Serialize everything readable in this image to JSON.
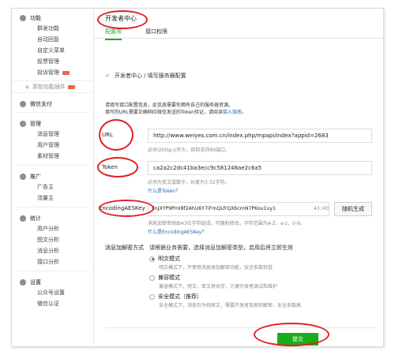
{
  "sidebar": {
    "groups": [
      {
        "title": "功能",
        "icon": "grid-icon",
        "items": [
          "群发功能",
          "自动回复",
          "自定义菜单",
          "投票管理",
          "投诉管理"
        ],
        "add_label": "添加功能插件"
      },
      {
        "title": "微信支付",
        "icon": "wallet-icon",
        "items": []
      },
      {
        "title": "管理",
        "icon": "folder-icon",
        "items": [
          "消息管理",
          "用户管理",
          "素材管理"
        ]
      },
      {
        "title": "推广",
        "icon": "megaphone-icon",
        "items": [
          "广告主",
          "流量主"
        ]
      },
      {
        "title": "统计",
        "icon": "chart-icon",
        "items": [
          "用户分析",
          "图文分析",
          "消息分析",
          "接口分析"
        ]
      },
      {
        "title": "设置",
        "icon": "gear-icon",
        "items": [
          "公众号设置",
          "微信认证"
        ]
      }
    ]
  },
  "header": {
    "title": "开发者中心",
    "tabs": [
      "配置项",
      "接口权限"
    ]
  },
  "breadcrumb": {
    "back": "<",
    "path": "开发者中心 / 填写服务器配置"
  },
  "intro": {
    "line1": "请填写接口配置信息，此信息需要你拥有自己的服务器资源。",
    "line2": "填写的URL需要正确响应微信发送的Token验证，请阅读",
    "link": "接入指南。"
  },
  "form": {
    "url": {
      "label": "URL",
      "value": "http://www.weiyes.com.cn/index.php/mpapi/index?appid=2683",
      "hint": "必须以http://开头，目前支持80端口。"
    },
    "token": {
      "label": "Token",
      "value": "ca2a2c2dc41ba3ecc9c581248ae2c6a5",
      "hint": "必须为英文或数字，长度为3-32字符。",
      "link": "什么是Token？"
    },
    "aes": {
      "label": "EncodingAESKey",
      "value": "lnJXYP9Pml8f2AhU6Y7iFmQLfrQXbcmN7PKou1uy1",
      "counter": "43 /43",
      "generate": "随机生成",
      "hint": "消息加密密钥由43位字符组成，可随机修改，字符范围为A-Z，a-z，0-9。",
      "link": "什么是EncodingAESKey？"
    },
    "encryption": {
      "label": "消息加解密方式",
      "desc": "请根据业务需要，选择消息加解密类型，启用后将立即生效",
      "options": [
        {
          "title": "明文模式",
          "desc": "明文模式下，不使用消息体加解密功能，安全系数较低",
          "checked": true
        },
        {
          "title": "兼容模式",
          "desc": "兼容模式下，明文、密文将共存，方便开发者调试和维护",
          "checked": false
        },
        {
          "title": "安全模式（推荐）",
          "desc": "安全模式下，消息包为纯密文，需要开发者加密和解密，安全系数高",
          "checked": false
        }
      ]
    }
  },
  "submit_label": "提交",
  "colors": {
    "accent": "#1aad19",
    "highlight": "#e02020",
    "link": "#2b5db7"
  }
}
